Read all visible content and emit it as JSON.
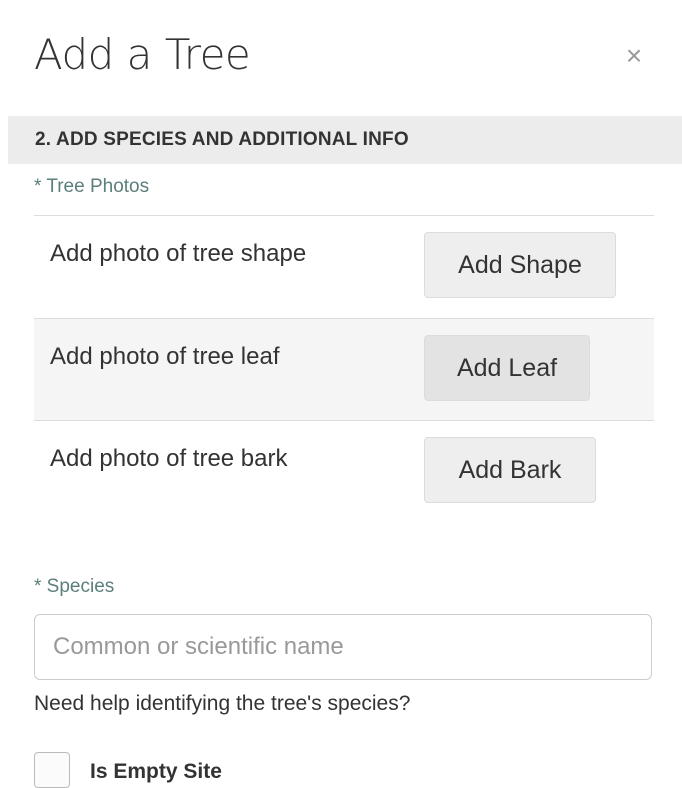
{
  "dialog": {
    "title": "Add a Tree",
    "close_symbol": "×"
  },
  "section": {
    "heading": "2. ADD SPECIES AND ADDITIONAL INFO"
  },
  "photos": {
    "label": "* Tree Photos",
    "rows": [
      {
        "prompt": "Add photo of tree shape",
        "button": "Add Shape"
      },
      {
        "prompt": "Add photo of tree leaf",
        "button": "Add Leaf"
      },
      {
        "prompt": "Add photo of tree bark",
        "button": "Add Bark"
      }
    ]
  },
  "species": {
    "label": "* Species",
    "value": "",
    "placeholder": "Common or scientific name",
    "help": "Need help identifying the tree's species?"
  },
  "empty_site": {
    "label": "Is Empty Site",
    "checked": false
  },
  "colors": {
    "required_label": "#5b7f7c",
    "section_bar": "#ececec",
    "shaded_row": "#f5f5f5"
  }
}
